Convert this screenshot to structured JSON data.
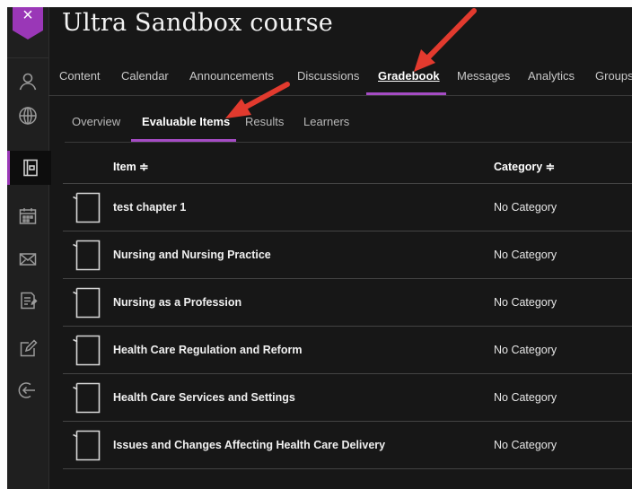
{
  "header": {
    "title": "Ultra Sandbox course",
    "close_glyph": "×"
  },
  "rail": {
    "accent": "#9a37b7",
    "icons": [
      "profile-icon",
      "globe-icon",
      "courses-icon",
      "calendar-icon",
      "messages-icon",
      "grades-icon",
      "tools-icon",
      "sign-out-icon"
    ]
  },
  "top_nav": {
    "tabs": [
      "Content",
      "Calendar",
      "Announcements",
      "Discussions",
      "Gradebook",
      "Messages",
      "Analytics",
      "Groups"
    ],
    "active": "Gradebook"
  },
  "sub_nav": {
    "tabs": [
      "Overview",
      "Evaluable Items",
      "Results",
      "Learners"
    ],
    "active": "Evaluable Items"
  },
  "table": {
    "columns": [
      "Item ≑",
      "Category ≑"
    ],
    "rows": [
      {
        "item": "test chapter 1",
        "category": "No Category"
      },
      {
        "item": "Nursing and Nursing Practice",
        "category": "No Category"
      },
      {
        "item": "Nursing as a Profession",
        "category": "No Category"
      },
      {
        "item": "Health Care Regulation and Reform",
        "category": "No Category"
      },
      {
        "item": "Health Care Services and Settings",
        "category": "No Category"
      },
      {
        "item": "Issues and Changes Affecting Health Care Delivery",
        "category": "No Category"
      }
    ]
  },
  "annotations": {
    "arrow_color": "#e23a2e",
    "arrow_count": 2
  }
}
